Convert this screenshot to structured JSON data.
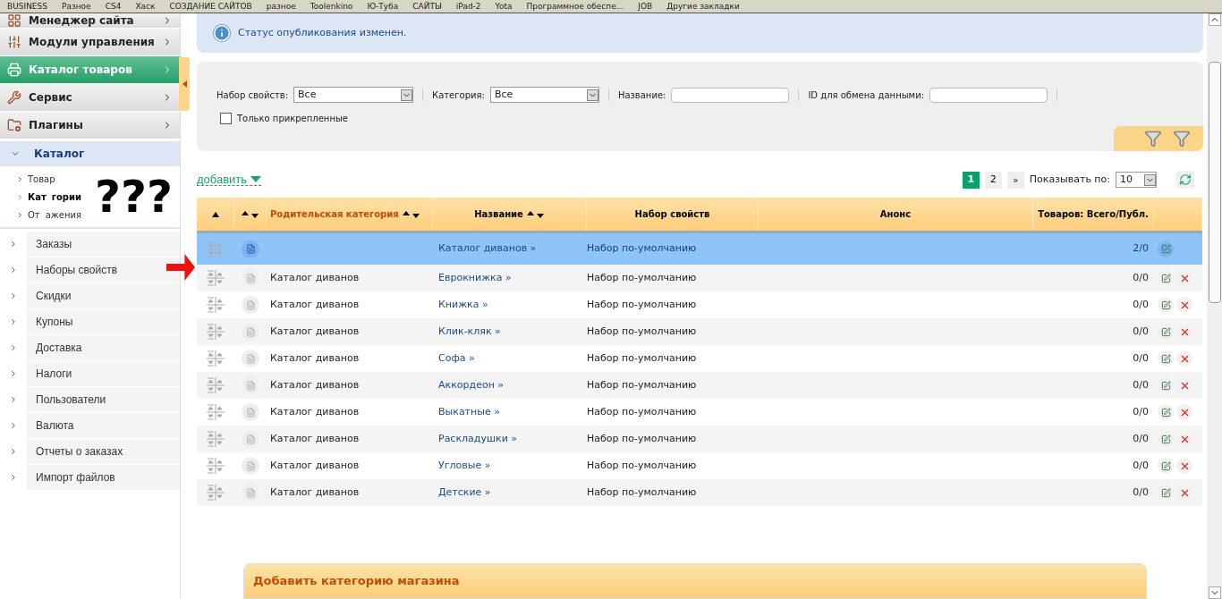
{
  "bookmarks": [
    "BUSINESS",
    "Разное",
    "CS4",
    "Хаск",
    "СОЗДАНИЕ САЙТОВ",
    "разное",
    "Toolenkino",
    "Ю-Туба",
    "САЙТЫ",
    "iPad-2",
    "Yota",
    "Программное обеспе...",
    "JOB",
    "Другие закладки"
  ],
  "sidebar": {
    "modules": [
      {
        "label": "Менеджер сайта",
        "selected": false
      },
      {
        "label": "Модули управления",
        "selected": false
      },
      {
        "label": "Каталог товаров",
        "selected": true
      },
      {
        "label": "Сервис",
        "selected": false
      },
      {
        "label": "Плагины",
        "selected": false
      }
    ],
    "section": {
      "label": "Каталог",
      "expanded": true,
      "items": [
        {
          "label": "Товар",
          "selected": false
        },
        {
          "label": "Кат",
          "tail": "гории",
          "selected": true
        },
        {
          "label": "От",
          "tail": "ажения",
          "selected": false
        }
      ]
    },
    "items": [
      "Заказы",
      "Наборы свойств",
      "Скидки",
      "Купоны",
      "Доставка",
      "Налоги",
      "Пользователи",
      "Валюта",
      "Отчеты о заказах",
      "Импорт файлов"
    ]
  },
  "annotation": "???",
  "notice": "Статус опубликования изменен.",
  "filters": {
    "property_set": {
      "label": "Набор свойств:",
      "value": "Все"
    },
    "category": {
      "label": "Категория:",
      "value": "Все"
    },
    "name": {
      "label": "Название:"
    },
    "exchange_id": {
      "label": "ID для обмена данными:"
    },
    "pinned": {
      "label": "Только прикрепленные",
      "checked": false
    }
  },
  "toolbar": {
    "add": "добавить",
    "pages": [
      {
        "label": "1",
        "selected": true
      },
      {
        "label": "2",
        "selected": false
      }
    ],
    "next": "»",
    "per_page": {
      "label": "Показывать по:",
      "value": "10"
    }
  },
  "table": {
    "columns": [
      {
        "kind": "up"
      },
      {
        "kind": "both"
      },
      {
        "label": "Родительская категория",
        "kind": "both",
        "active": true
      },
      {
        "label": "Название",
        "kind": "both",
        "active": false
      },
      {
        "label": "Набор свойств",
        "kind": "plain",
        "active": false
      },
      {
        "label": "Анонс",
        "kind": "plain",
        "active": false
      },
      {
        "label": "Товаров: Всего/Публ.",
        "kind": "plain",
        "active": false
      },
      {
        "kind": "plain"
      }
    ],
    "rows": [
      {
        "name": "Каталог диванов »",
        "property_set": "Набор по-умолчанию",
        "count": "2/0",
        "selected": true,
        "deletable": false
      },
      {
        "parent": "Каталог диванов",
        "name": "Еврокнижка »",
        "property_set": "Набор по-умолчанию",
        "count": "0/0",
        "selected": false,
        "deletable": true
      },
      {
        "parent": "Каталог диванов",
        "name": "Книжка »",
        "property_set": "Набор по-умолчанию",
        "count": "0/0",
        "selected": false,
        "deletable": true
      },
      {
        "parent": "Каталог диванов",
        "name": "Клик-кляк »",
        "property_set": "Набор по-умолчанию",
        "count": "0/0",
        "selected": false,
        "deletable": true
      },
      {
        "parent": "Каталог диванов",
        "name": "Софа »",
        "property_set": "Набор по-умолчанию",
        "count": "0/0",
        "selected": false,
        "deletable": true
      },
      {
        "parent": "Каталог диванов",
        "name": "Аккордеон »",
        "property_set": "Набор по-умолчанию",
        "count": "0/0",
        "selected": false,
        "deletable": true
      },
      {
        "parent": "Каталог диванов",
        "name": "Выкатные »",
        "property_set": "Набор по-умолчанию",
        "count": "0/0",
        "selected": false,
        "deletable": true
      },
      {
        "parent": "Каталог диванов",
        "name": "Раскладушки »",
        "property_set": "Набор по-умолчанию",
        "count": "0/0",
        "selected": false,
        "deletable": true
      },
      {
        "parent": "Каталог диванов",
        "name": "Угловые »",
        "property_set": "Набор по-умолчанию",
        "count": "0/0",
        "selected": false,
        "deletable": true
      },
      {
        "parent": "Каталог диванов",
        "name": "Детские »",
        "property_set": "Набор по-умолчанию",
        "count": "0/0",
        "selected": false,
        "deletable": true
      }
    ]
  },
  "add_panel": {
    "title": "Добавить категорию магазина"
  }
}
